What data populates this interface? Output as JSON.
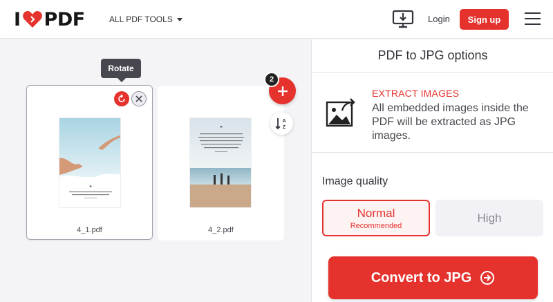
{
  "header": {
    "logo_left": "I",
    "logo_right": "PDF",
    "tools_menu": "ALL PDF TOOLS",
    "login": "Login",
    "signup": "Sign up"
  },
  "workspace": {
    "tooltip": "Rotate",
    "file_count": "2",
    "files": [
      {
        "name": "4_1.pdf"
      },
      {
        "name": "4_2.pdf"
      }
    ]
  },
  "sidebar": {
    "title": "PDF to JPG options",
    "extract_title": "EXTRACT IMAGES",
    "extract_desc": "All embedded images inside the PDF will be extracted as JPG images.",
    "quality_label": "Image quality",
    "quality_normal": "Normal",
    "quality_normal_sub": "Recommended",
    "quality_high": "High",
    "convert": "Convert to JPG"
  },
  "colors": {
    "accent": "#e5322d",
    "text": "#33333b",
    "panel_bg": "#f4f4f7"
  }
}
